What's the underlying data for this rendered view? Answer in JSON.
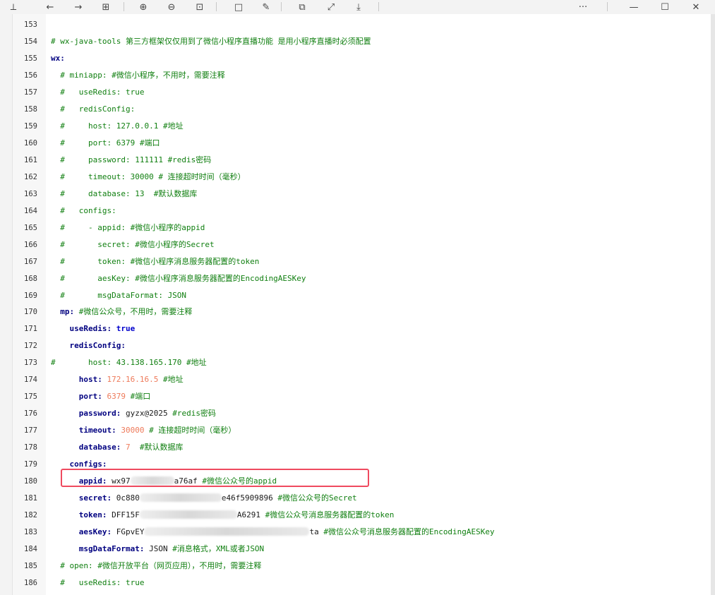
{
  "toolbar": {
    "buttons": [
      {
        "name": "pin-icon",
        "glyph": "⟂"
      },
      {
        "name": "back-arrow-icon",
        "glyph": "←"
      },
      {
        "name": "forward-arrow-icon",
        "glyph": "→"
      },
      {
        "name": "grid-view-icon",
        "glyph": "⊞"
      },
      {
        "name": "zoom-in-icon",
        "glyph": "⊕"
      },
      {
        "name": "zoom-out-icon",
        "glyph": "⊖"
      },
      {
        "name": "fit-page-icon",
        "glyph": "⊡"
      },
      {
        "name": "rectangle-icon",
        "glyph": "□"
      },
      {
        "name": "edit-icon",
        "glyph": "✎"
      },
      {
        "name": "copy-icon",
        "glyph": "⧉"
      },
      {
        "name": "expand-icon",
        "glyph": "⤢"
      },
      {
        "name": "save-icon",
        "glyph": "⤓"
      },
      {
        "name": "more-icon",
        "glyph": "···"
      },
      {
        "name": "minimize-icon",
        "glyph": "—"
      },
      {
        "name": "maximize-icon",
        "glyph": "☐"
      },
      {
        "name": "close-icon",
        "glyph": "✕"
      }
    ]
  },
  "code_lines": [
    {
      "n": "153",
      "parts": []
    },
    {
      "n": "154",
      "parts": [
        {
          "t": "# wx-java-tools 第三方框架仅仅用到了微信小程序直播功能 是用小程序直播时必须配置",
          "c": "t-com"
        }
      ]
    },
    {
      "n": "155",
      "parts": [
        {
          "t": "wx:",
          "c": "t-key"
        }
      ]
    },
    {
      "n": "156",
      "parts": [
        {
          "t": "  # miniapp: #微信小程序，不用时，需要注释",
          "c": "t-com"
        }
      ]
    },
    {
      "n": "157",
      "parts": [
        {
          "t": "  #   useRedis: true",
          "c": "t-com"
        }
      ]
    },
    {
      "n": "158",
      "parts": [
        {
          "t": "  #   redisConfig:",
          "c": "t-com"
        }
      ]
    },
    {
      "n": "159",
      "parts": [
        {
          "t": "  #     host: 127.0.0.1 #地址",
          "c": "t-com"
        }
      ]
    },
    {
      "n": "160",
      "parts": [
        {
          "t": "  #     port: 6379 #端口",
          "c": "t-com"
        }
      ]
    },
    {
      "n": "161",
      "parts": [
        {
          "t": "  #     password: 111111 #redis密码",
          "c": "t-com"
        }
      ]
    },
    {
      "n": "162",
      "parts": [
        {
          "t": "  #     timeout: 30000 # 连接超时时间（毫秒）",
          "c": "t-com"
        }
      ]
    },
    {
      "n": "163",
      "parts": [
        {
          "t": "  #     database: 13  #默认数据库",
          "c": "t-com"
        }
      ]
    },
    {
      "n": "164",
      "parts": [
        {
          "t": "  #   configs:",
          "c": "t-com"
        }
      ]
    },
    {
      "n": "165",
      "parts": [
        {
          "t": "  #     - appid: #微信小程序的appid",
          "c": "t-com"
        }
      ]
    },
    {
      "n": "166",
      "parts": [
        {
          "t": "  #       secret: #微信小程序的Secret",
          "c": "t-com"
        }
      ]
    },
    {
      "n": "167",
      "parts": [
        {
          "t": "  #       token: #微信小程序消息服务器配置的token",
          "c": "t-com"
        }
      ]
    },
    {
      "n": "168",
      "parts": [
        {
          "t": "  #       aesKey: #微信小程序消息服务器配置的EncodingAESKey",
          "c": "t-com"
        }
      ]
    },
    {
      "n": "169",
      "parts": [
        {
          "t": "  #       msgDataFormat: JSON",
          "c": "t-com"
        }
      ]
    },
    {
      "n": "170",
      "parts": [
        {
          "t": "  mp:",
          "c": "t-key"
        },
        {
          "t": " #微信公众号，不用时，需要注释",
          "c": "t-cm"
        }
      ]
    },
    {
      "n": "171",
      "parts": [
        {
          "t": "    useRedis:",
          "c": "t-key"
        },
        {
          "t": " true",
          "c": "t-bool"
        }
      ]
    },
    {
      "n": "172",
      "parts": [
        {
          "t": "    redisConfig:",
          "c": "t-key"
        }
      ]
    },
    {
      "n": "173",
      "parts": [
        {
          "t": "#       host: 43.138.165.170 #地址",
          "c": "t-com"
        }
      ]
    },
    {
      "n": "174",
      "parts": [
        {
          "t": "      host:",
          "c": "t-key"
        },
        {
          "t": " 172.16.16.5",
          "c": "t-num"
        },
        {
          "t": " #地址",
          "c": "t-cm"
        }
      ]
    },
    {
      "n": "175",
      "parts": [
        {
          "t": "      port:",
          "c": "t-key"
        },
        {
          "t": " 6379",
          "c": "t-num"
        },
        {
          "t": " #端口",
          "c": "t-cm"
        }
      ]
    },
    {
      "n": "176",
      "parts": [
        {
          "t": "      password:",
          "c": "t-key"
        },
        {
          "t": " gyzx@2025",
          "c": "t-val"
        },
        {
          "t": " #redis密码",
          "c": "t-cm"
        }
      ]
    },
    {
      "n": "177",
      "parts": [
        {
          "t": "      timeout:",
          "c": "t-key"
        },
        {
          "t": " 30000",
          "c": "t-num"
        },
        {
          "t": " # 连接超时时间（毫秒）",
          "c": "t-cm"
        }
      ]
    },
    {
      "n": "178",
      "parts": [
        {
          "t": "      database:",
          "c": "t-key"
        },
        {
          "t": " 7",
          "c": "t-num"
        },
        {
          "t": "  #默认数据库",
          "c": "t-cm"
        }
      ]
    },
    {
      "n": "179",
      "parts": [
        {
          "t": "    configs:",
          "c": "t-key"
        }
      ]
    },
    {
      "n": "180",
      "parts": [
        {
          "t": "      appid:",
          "c": "t-key"
        },
        {
          "t": " wx97",
          "c": "t-val"
        },
        {
          "r": 62
        },
        {
          "t": "a76af",
          "c": "t-val"
        },
        {
          "t": " #微信公众号的appid",
          "c": "t-cm"
        }
      ]
    },
    {
      "n": "181",
      "parts": [
        {
          "t": "      secret:",
          "c": "t-key"
        },
        {
          "t": " 0c880",
          "c": "t-val"
        },
        {
          "r": 116
        },
        {
          "t": "e46f5909896",
          "c": "t-val"
        },
        {
          "t": " #微信公众号的Secret",
          "c": "t-cm"
        }
      ]
    },
    {
      "n": "182",
      "parts": [
        {
          "t": "      token:",
          "c": "t-key"
        },
        {
          "t": " DFF15F",
          "c": "t-val"
        },
        {
          "r": 138
        },
        {
          "t": "A6291",
          "c": "t-val"
        },
        {
          "t": " #微信公众号消息服务器配置的token",
          "c": "t-cm"
        }
      ]
    },
    {
      "n": "183",
      "parts": [
        {
          "t": "      aesKey:",
          "c": "t-key"
        },
        {
          "t": " FGpvEY",
          "c": "t-val"
        },
        {
          "r": 234
        },
        {
          "t": "ta",
          "c": "t-val"
        },
        {
          "t": " #微信公众号消息服务器配置的EncodingAESKey",
          "c": "t-cm"
        }
      ]
    },
    {
      "n": "184",
      "parts": [
        {
          "t": "      msgDataFormat:",
          "c": "t-key"
        },
        {
          "t": " JSON",
          "c": "t-val"
        },
        {
          "t": " #消息格式，XML或者JSON",
          "c": "t-cm"
        }
      ]
    },
    {
      "n": "185",
      "parts": [
        {
          "t": "  # open: #微信开放平台（网页应用），不用时，需要注释",
          "c": "t-com"
        }
      ]
    },
    {
      "n": "186",
      "parts": [
        {
          "t": "  #   useRedis: true",
          "c": "t-com"
        }
      ]
    }
  ],
  "colors": {
    "highlight": "#ef4a5f",
    "comment": "#107f10",
    "key": "#000080",
    "number": "#ee7a5a"
  }
}
